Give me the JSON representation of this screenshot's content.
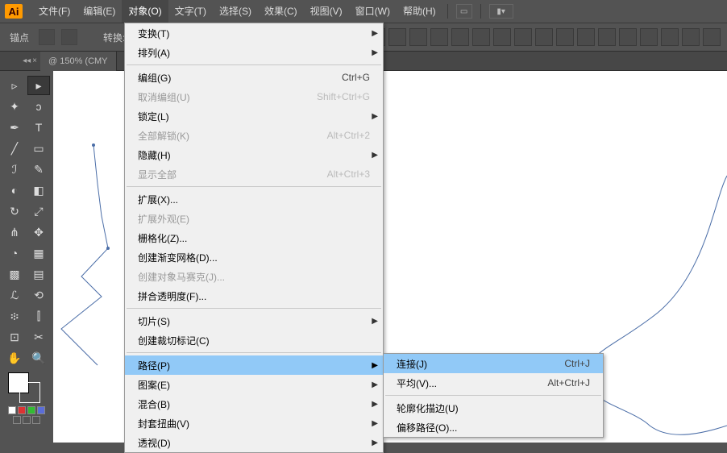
{
  "app": {
    "logo": "Ai"
  },
  "menubar": {
    "items": [
      {
        "label": "文件(F)"
      },
      {
        "label": "编辑(E)"
      },
      {
        "label": "对象(O)"
      },
      {
        "label": "文字(T)"
      },
      {
        "label": "选择(S)"
      },
      {
        "label": "效果(C)"
      },
      {
        "label": "视图(V)"
      },
      {
        "label": "窗口(W)"
      },
      {
        "label": "帮助(H)"
      }
    ],
    "activeIndex": 2
  },
  "optionbar": {
    "anchor_label": "锚点",
    "convert_label": "转换:"
  },
  "tab": {
    "title": "@ 150% (CMY"
  },
  "dropdown": {
    "items": [
      {
        "label": "变换(T)",
        "sub": true
      },
      {
        "label": "排列(A)",
        "sub": true
      },
      {
        "type": "divider"
      },
      {
        "label": "编组(G)",
        "shortcut": "Ctrl+G"
      },
      {
        "label": "取消编组(U)",
        "shortcut": "Shift+Ctrl+G",
        "disabled": true
      },
      {
        "label": "锁定(L)",
        "sub": true
      },
      {
        "label": "全部解锁(K)",
        "shortcut": "Alt+Ctrl+2",
        "disabled": true
      },
      {
        "label": "隐藏(H)",
        "sub": true
      },
      {
        "label": "显示全部",
        "shortcut": "Alt+Ctrl+3",
        "disabled": true
      },
      {
        "type": "divider"
      },
      {
        "label": "扩展(X)..."
      },
      {
        "label": "扩展外观(E)",
        "disabled": true
      },
      {
        "label": "栅格化(Z)..."
      },
      {
        "label": "创建渐变网格(D)..."
      },
      {
        "label": "创建对象马赛克(J)...",
        "disabled": true
      },
      {
        "label": "拼合透明度(F)..."
      },
      {
        "type": "divider"
      },
      {
        "label": "切片(S)",
        "sub": true
      },
      {
        "label": "创建裁切标记(C)"
      },
      {
        "type": "divider"
      },
      {
        "label": "路径(P)",
        "sub": true,
        "highlight": true
      },
      {
        "label": "图案(E)",
        "sub": true
      },
      {
        "label": "混合(B)",
        "sub": true
      },
      {
        "label": "封套扭曲(V)",
        "sub": true
      },
      {
        "label": "透视(D)",
        "sub": true
      }
    ]
  },
  "submenu": {
    "items": [
      {
        "label": "连接(J)",
        "shortcut": "Ctrl+J",
        "highlight": true
      },
      {
        "label": "平均(V)...",
        "shortcut": "Alt+Ctrl+J"
      },
      {
        "type": "divider"
      },
      {
        "label": "轮廓化描边(U)"
      },
      {
        "label": "偏移路径(O)..."
      }
    ]
  }
}
